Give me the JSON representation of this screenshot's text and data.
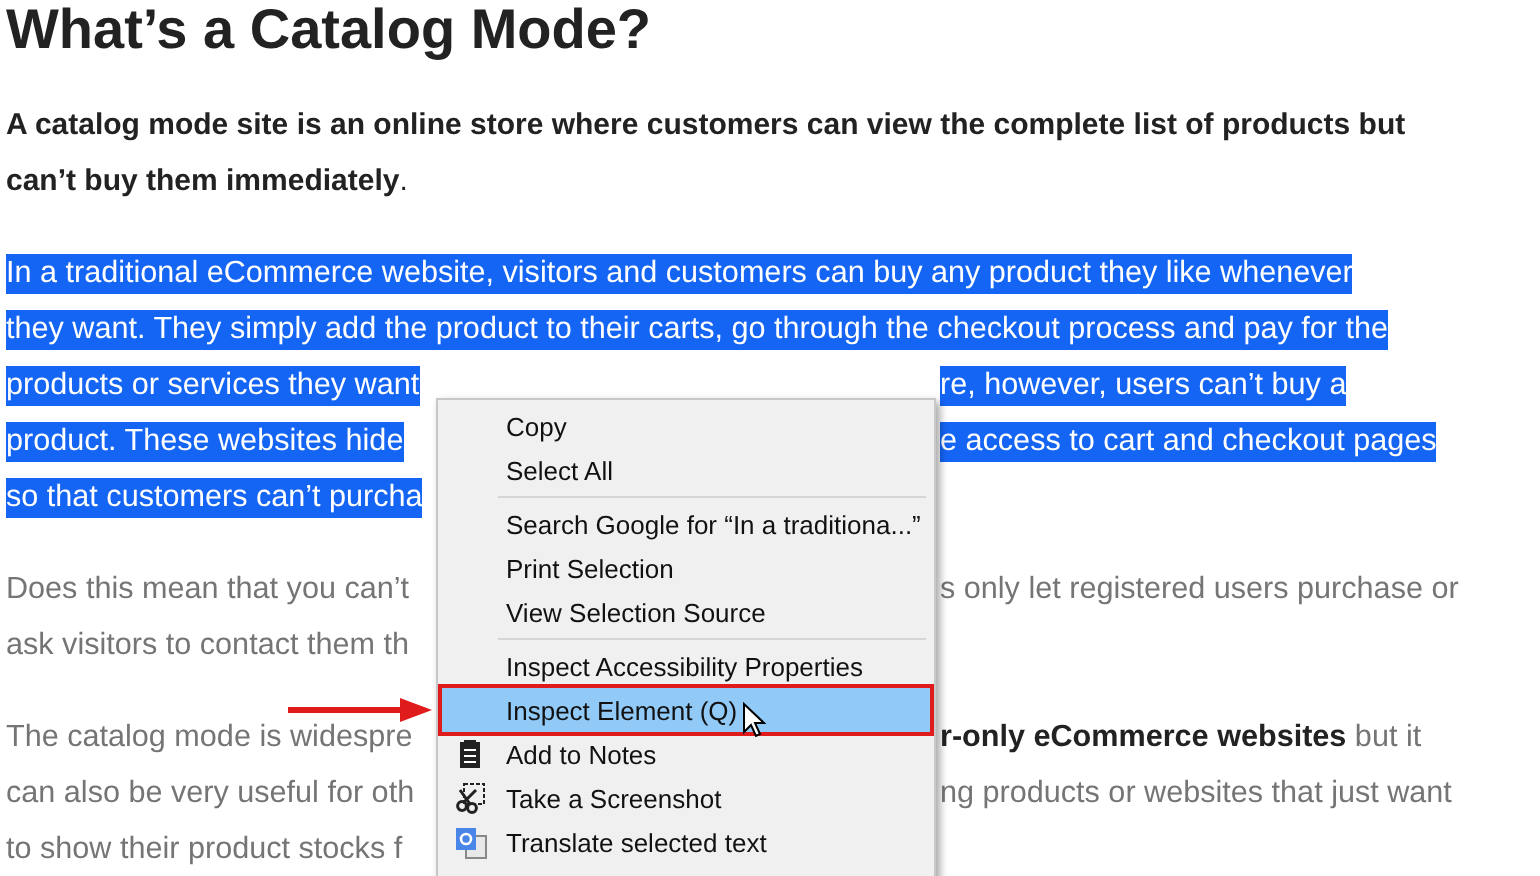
{
  "heading": "What’s a Catalog Mode?",
  "intro": {
    "lines": [
      "**A catalog mode site is an online store where customers can view the complete list of products but**",
      "**can’t buy them immediately**."
    ]
  },
  "paragraphs": [
    {
      "selected": true,
      "lines": [
        {
          "left": "In a traditional eCommerce website, visitors and customers can buy any product they like whenever"
        },
        {
          "left": "they want. They simply add the product to their carts, go through the checkout process and pay for the"
        },
        {
          "left": "products or services they want",
          "right": "re, however, users can’t buy a"
        },
        {
          "left": "product. These websites hide",
          "right": "e access to cart and checkout pages"
        },
        {
          "left": "so that customers can’t purcha"
        }
      ]
    },
    {
      "selected": false,
      "lines": [
        {
          "left": "Does this mean that you can’t",
          "right": "s only let registered users purchase or"
        },
        {
          "left": "ask visitors to contact them th"
        }
      ]
    },
    {
      "selected": false,
      "lines": [
        {
          "left": "The catalog mode is widespre",
          "right": "**r-only eCommerce websites** but it"
        },
        {
          "left": "can also be very useful for oth",
          "right": "ng products or websites that just want"
        },
        {
          "left": "to show their product stocks f"
        }
      ]
    }
  ],
  "context_menu": {
    "items": [
      {
        "kind": "item",
        "label": "Copy",
        "selected": false
      },
      {
        "kind": "item",
        "label": "Select All",
        "selected": false
      },
      {
        "kind": "separator"
      },
      {
        "kind": "item",
        "label": "Search Google for “In a traditiona...”",
        "selected": false
      },
      {
        "kind": "item",
        "label": "Print Selection",
        "selected": false
      },
      {
        "kind": "item",
        "label": "View Selection Source",
        "selected": false
      },
      {
        "kind": "separator"
      },
      {
        "kind": "item",
        "label": "Inspect Accessibility Properties",
        "selected": false
      },
      {
        "kind": "item",
        "label": "Inspect Element (Q)",
        "selected": true
      },
      {
        "kind": "notes",
        "label": "Add to Notes",
        "selected": false
      },
      {
        "kind": "screenshot",
        "label": "Take a Screenshot",
        "selected": false
      },
      {
        "kind": "translate",
        "label": "Translate selected text",
        "selected": false
      }
    ]
  }
}
